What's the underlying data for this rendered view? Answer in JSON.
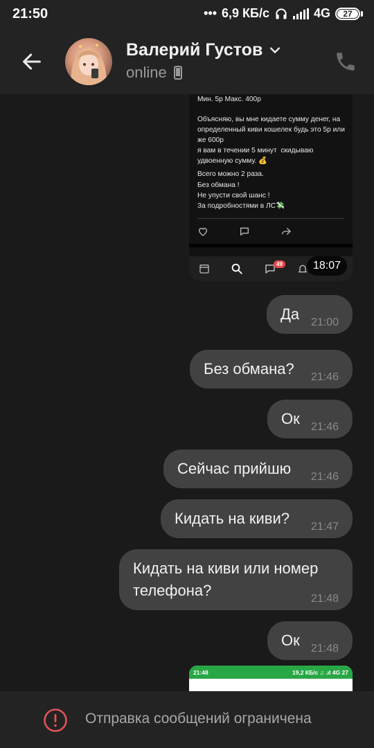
{
  "status_bar": {
    "time": "21:50",
    "net_speed": "6,9 КБ/с",
    "network": "4G",
    "battery": "27"
  },
  "header": {
    "contact_name": "Валерий Густов",
    "status": "online"
  },
  "screenshot_card": {
    "lines": [
      "Мин. 5р Макс. 400р",
      "",
      "Объясняю, вы мне кидаете сумму денег, на определенный киви кошелек будь это 5р или же 600р",
      "я вам в течении 5 минут  скидываю удвоенную сумму. 💰",
      "Всего можно 2 раза.",
      "Без обмана !",
      "Не упусти свой шанс !",
      "За подробностями в ЛС💸"
    ],
    "badge_count": "49",
    "time": "18:07"
  },
  "messages": [
    {
      "text": "Да",
      "time": "21:00"
    },
    {
      "text": "Без обмана?",
      "time": "21:46"
    },
    {
      "text": "Ок",
      "time": "21:46"
    },
    {
      "text": "Сейчас прийшю",
      "time": "21:46"
    },
    {
      "text": "Кидать на киви?",
      "time": "21:47"
    },
    {
      "text": "Кидать на киви или номер\nтелефона?",
      "time": "21:48"
    },
    {
      "text": "Ок",
      "time": "21:48"
    }
  ],
  "screenshot_card2": {
    "time": "21:48",
    "status": "19,2 КБ/с ♫ .ıl 4G 27"
  },
  "footer": {
    "text": "Отправка сообщений ограничена"
  },
  "colors": {
    "background": "#1a1a1a",
    "bar": "#232323",
    "bubble": "#424242",
    "warning": "#e05454"
  }
}
